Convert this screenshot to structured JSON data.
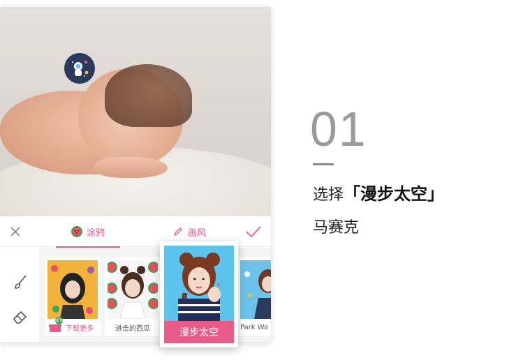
{
  "tabs": {
    "graffiti_label": "涂鸦",
    "style_label": "画风"
  },
  "filters": [
    {
      "label": "下载更多",
      "badge": "NEW"
    },
    {
      "label": "进击的西瓜"
    },
    {
      "label": "Park Wa"
    }
  ],
  "selected_filter": {
    "label": "漫步太空"
  },
  "step": {
    "number": "01",
    "line1_prefix": "选择",
    "line1_highlight": "「漫步太空」",
    "line2": "马赛克"
  },
  "colors": {
    "accent": "#e85a8a",
    "step_number": "#9a9a9a"
  },
  "icons": {
    "close": "close-icon",
    "graffiti": "watermelon-icon",
    "style": "pencil-icon",
    "confirm": "check-icon",
    "brush": "brush-icon",
    "eraser": "eraser-icon"
  }
}
